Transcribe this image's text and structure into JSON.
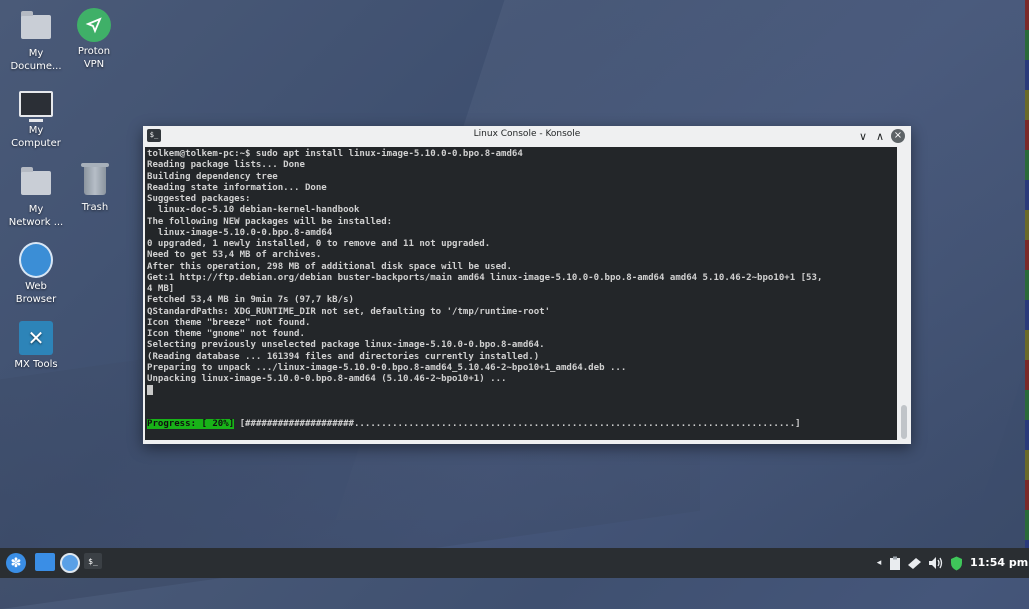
{
  "desktop": {
    "icons": [
      {
        "label": "My Docume..."
      },
      {
        "label": "Proton VPN"
      },
      {
        "label": "My Computer"
      },
      {
        "label": "My Network ..."
      },
      {
        "label": "Trash"
      },
      {
        "label": "Web Browser"
      },
      {
        "label": "MX Tools"
      }
    ]
  },
  "window": {
    "title": "Linux Console - Konsole",
    "app_icon_text": "$_",
    "minimize_glyph": "∨",
    "maximize_glyph": "∧",
    "close_glyph": "×"
  },
  "terminal": {
    "lines": [
      "tolkem@tolkem-pc:~$ sudo apt install linux-image-5.10.0-0.bpo.8-amd64",
      "Reading package lists... Done",
      "Building dependency tree",
      "Reading state information... Done",
      "Suggested packages:",
      "  linux-doc-5.10 debian-kernel-handbook",
      "The following NEW packages will be installed:",
      "  linux-image-5.10.0-0.bpo.8-amd64",
      "0 upgraded, 1 newly installed, 0 to remove and 11 not upgraded.",
      "Need to get 53,4 MB of archives.",
      "After this operation, 298 MB of additional disk space will be used.",
      "Get:1 http://ftp.debian.org/debian buster-backports/main amd64 linux-image-5.10.0-0.bpo.8-amd64 amd64 5.10.46-2~bpo10+1 [53,",
      "4 MB]",
      "Fetched 53,4 MB in 9min 7s (97,7 kB/s)",
      "QStandardPaths: XDG_RUNTIME_DIR not set, defaulting to '/tmp/runtime-root'",
      "Icon theme \"breeze\" not found.",
      "Icon theme \"gnome\" not found.",
      "Selecting previously unselected package linux-image-5.10.0-0.bpo.8-amd64.",
      "(Reading database ... 161394 files and directories currently installed.)",
      "Preparing to unpack .../linux-image-5.10.0-0.bpo.8-amd64_5.10.46-2~bpo10+1_amd64.deb ...",
      "Unpacking linux-image-5.10.0-0.bpo.8-amd64 (5.10.46-2~bpo10+1) ..."
    ],
    "progress_label": "Progress: [ 20%]",
    "progress_bar": " [####################.................................................................................]",
    "progress_percent": 20
  },
  "taskbar": {
    "konsole_text": "$_",
    "clock": "11:54 pm",
    "tray_arrow": "◂"
  }
}
